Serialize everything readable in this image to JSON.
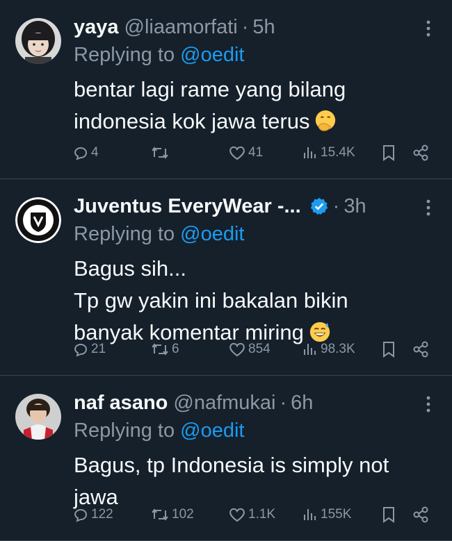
{
  "colors": {
    "background": "#15202b",
    "text": "#f7f9f9",
    "secondary": "#8b98a5",
    "link": "#1d9bf0",
    "divider": "#38444d",
    "verified": "#1d9bf0"
  },
  "tweets": [
    {
      "name": "yaya",
      "handle": "@liaamorfati",
      "separator": "·",
      "time": "5h",
      "verified": false,
      "replying_prefix": "Replying to ",
      "replying_mention": "@oedit",
      "text": "bentar lagi rame yang bilang\nindonesia kok jawa terus",
      "emoji": "smiling-face-with-hand-over-mouth",
      "replies": "4",
      "retweets": "",
      "likes": "41",
      "views": "15.4K"
    },
    {
      "name": "Juventus EveryWear -...",
      "handle": "",
      "separator": "·",
      "time": "3h",
      "verified": true,
      "replying_prefix": "Replying to ",
      "replying_mention": "@oedit",
      "text": "Bagus sih...\nTp gw yakin ini bakalan bikin\nbanyak komentar miring",
      "emoji": "grinning-face-with-sweat",
      "replies": "21",
      "retweets": "6",
      "likes": "854",
      "views": "98.3K"
    },
    {
      "name": "naf asano",
      "handle": "@nafmukai",
      "separator": "·",
      "time": "6h",
      "verified": false,
      "replying_prefix": "Replying to ",
      "replying_mention": "@oedit",
      "text": "Bagus, tp Indonesia is simply not\njawa",
      "emoji": "",
      "replies": "122",
      "retweets": "102",
      "likes": "1.1K",
      "views": "155K"
    }
  ]
}
